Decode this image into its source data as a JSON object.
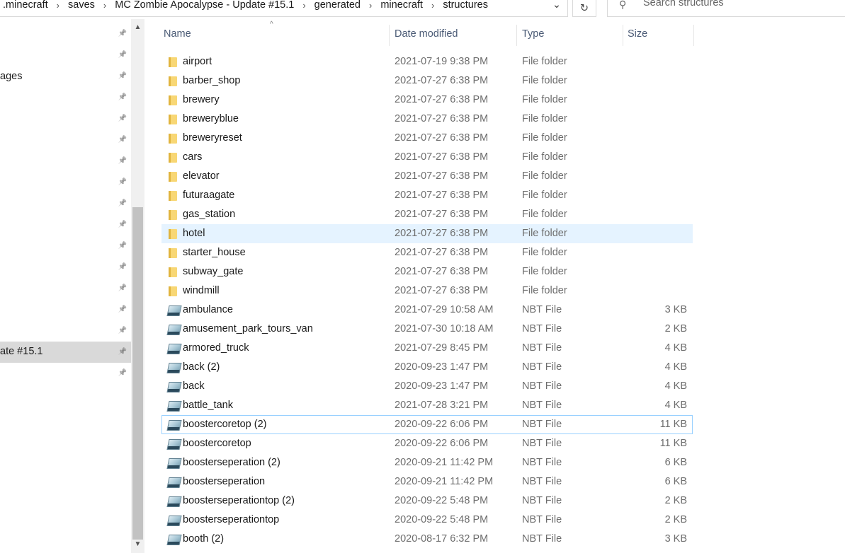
{
  "address": {
    "crumbs": [
      ".minecraft",
      "saves",
      "MC Zombie Apocalypse - Update #15.1",
      "generated",
      "minecraft",
      "structures"
    ],
    "separator": "›",
    "dropdown": "⌄",
    "refresh": "↻"
  },
  "search": {
    "placeholder": "Search structures"
  },
  "nav": {
    "items": [
      {
        "label": "ages"
      },
      {
        "label": "ate #15.1"
      }
    ]
  },
  "columns": {
    "name": "Name",
    "date": "Date modified",
    "type": "Type",
    "size": "Size"
  },
  "files": [
    {
      "name": "airport",
      "date": "2021-07-19 9:38 PM",
      "type": "File folder",
      "size": "",
      "kind": "folder"
    },
    {
      "name": "barber_shop",
      "date": "2021-07-27 6:38 PM",
      "type": "File folder",
      "size": "",
      "kind": "folder"
    },
    {
      "name": "brewery",
      "date": "2021-07-27 6:38 PM",
      "type": "File folder",
      "size": "",
      "kind": "folder"
    },
    {
      "name": "breweryblue",
      "date": "2021-07-27 6:38 PM",
      "type": "File folder",
      "size": "",
      "kind": "folder"
    },
    {
      "name": "breweryreset",
      "date": "2021-07-27 6:38 PM",
      "type": "File folder",
      "size": "",
      "kind": "folder"
    },
    {
      "name": "cars",
      "date": "2021-07-27 6:38 PM",
      "type": "File folder",
      "size": "",
      "kind": "folder"
    },
    {
      "name": "elevator",
      "date": "2021-07-27 6:38 PM",
      "type": "File folder",
      "size": "",
      "kind": "folder"
    },
    {
      "name": "futuraagate",
      "date": "2021-07-27 6:38 PM",
      "type": "File folder",
      "size": "",
      "kind": "folder"
    },
    {
      "name": "gas_station",
      "date": "2021-07-27 6:38 PM",
      "type": "File folder",
      "size": "",
      "kind": "folder"
    },
    {
      "name": "hotel",
      "date": "2021-07-27 6:38 PM",
      "type": "File folder",
      "size": "",
      "kind": "folder",
      "state": "hover"
    },
    {
      "name": "starter_house",
      "date": "2021-07-27 6:38 PM",
      "type": "File folder",
      "size": "",
      "kind": "folder"
    },
    {
      "name": "subway_gate",
      "date": "2021-07-27 6:38 PM",
      "type": "File folder",
      "size": "",
      "kind": "folder"
    },
    {
      "name": "windmill",
      "date": "2021-07-27 6:38 PM",
      "type": "File folder",
      "size": "",
      "kind": "folder"
    },
    {
      "name": "ambulance",
      "date": "2021-07-29 10:58 AM",
      "type": "NBT File",
      "size": "3 KB",
      "kind": "file"
    },
    {
      "name": "amusement_park_tours_van",
      "date": "2021-07-30 10:18 AM",
      "type": "NBT File",
      "size": "2 KB",
      "kind": "file"
    },
    {
      "name": "armored_truck",
      "date": "2021-07-29 8:45 PM",
      "type": "NBT File",
      "size": "4 KB",
      "kind": "file"
    },
    {
      "name": "back (2)",
      "date": "2020-09-23 1:47 PM",
      "type": "NBT File",
      "size": "4 KB",
      "kind": "file"
    },
    {
      "name": "back",
      "date": "2020-09-23 1:47 PM",
      "type": "NBT File",
      "size": "4 KB",
      "kind": "file"
    },
    {
      "name": "battle_tank",
      "date": "2021-07-28 3:21 PM",
      "type": "NBT File",
      "size": "4 KB",
      "kind": "file"
    },
    {
      "name": "boostercoretop (2)",
      "date": "2020-09-22 6:06 PM",
      "type": "NBT File",
      "size": "11 KB",
      "kind": "file",
      "state": "focus"
    },
    {
      "name": "boostercoretop",
      "date": "2020-09-22 6:06 PM",
      "type": "NBT File",
      "size": "11 KB",
      "kind": "file"
    },
    {
      "name": "boosterseperation (2)",
      "date": "2020-09-21 11:42 PM",
      "type": "NBT File",
      "size": "6 KB",
      "kind": "file"
    },
    {
      "name": "boosterseperation",
      "date": "2020-09-21 11:42 PM",
      "type": "NBT File",
      "size": "6 KB",
      "kind": "file"
    },
    {
      "name": "boosterseperationtop (2)",
      "date": "2020-09-22 5:48 PM",
      "type": "NBT File",
      "size": "2 KB",
      "kind": "file"
    },
    {
      "name": "boosterseperationtop",
      "date": "2020-09-22 5:48 PM",
      "type": "NBT File",
      "size": "2 KB",
      "kind": "file"
    },
    {
      "name": "booth (2)",
      "date": "2020-08-17 6:32 PM",
      "type": "NBT File",
      "size": "3 KB",
      "kind": "file"
    }
  ],
  "icons": {
    "folder": "folder-icon",
    "file": "nbt-file-icon",
    "pin": "pin-icon",
    "search": "search-icon"
  },
  "colors": {
    "hover": "#e5f3ff",
    "focus_border": "#99d1ff",
    "nav_selected": "#d9d9d9",
    "header_text": "#4a5a75"
  }
}
